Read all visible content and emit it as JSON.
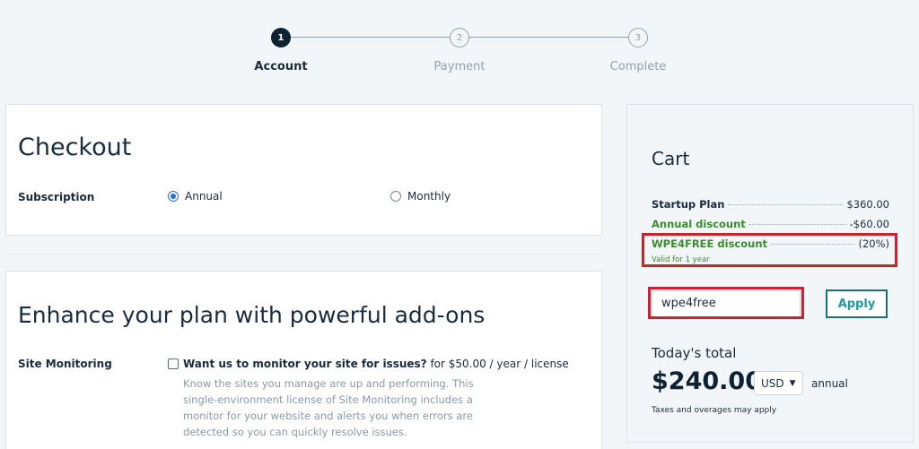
{
  "stepper": {
    "steps": [
      {
        "number": "1",
        "label": "Account"
      },
      {
        "number": "2",
        "label": "Payment"
      },
      {
        "number": "3",
        "label": "Complete"
      }
    ]
  },
  "checkout": {
    "title": "Checkout",
    "subscription_label": "Subscription",
    "options": [
      "Annual",
      "Monthly"
    ]
  },
  "addons": {
    "title": "Enhance your plan with powerful add-ons",
    "site_monitoring_label": "Site Monitoring",
    "question_bold": "Want us to monitor your site for issues?",
    "question_price": " for $50.00 / year / license",
    "description": "Know the sites you manage are up and performing. This single-environment license of Site Monitoring includes a monitor for your website and alerts you when errors are detected so you can quickly resolve issues."
  },
  "cart": {
    "title": "Cart",
    "lines": [
      {
        "label": "Startup Plan",
        "amount": "$360.00"
      },
      {
        "label": "Annual discount",
        "amount": "-$60.00"
      },
      {
        "label": "WPE4FREE discount",
        "amount": "(20%)"
      }
    ],
    "valid_note": "Valid for 1 year",
    "coupon_value": "wpe4free",
    "apply_label": "Apply",
    "today_label": "Today's total",
    "total": "$240.00",
    "currency": "USD",
    "period": "annual",
    "taxes_note": "Taxes and overages may apply"
  },
  "colors": {
    "highlight_red": "#d0202e",
    "discount_green": "#3d8b2f",
    "apply_teal": "#1c9c9c"
  }
}
